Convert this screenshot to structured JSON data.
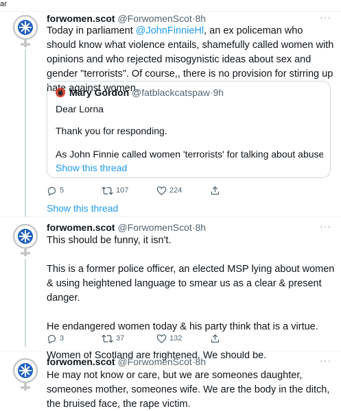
{
  "topbar": {
    "fragment": "ar"
  },
  "colors": {
    "link": "#1d9bf0",
    "muted": "#536471",
    "text": "#0f1419",
    "border": "#cfd9de"
  },
  "tweets": [
    {
      "name": "forwomen.scot",
      "handle": "@ForwomenScot",
      "time": "8h",
      "avatar_icon": "venus-logo-icon",
      "text": {
        "before": "Today in parliament ",
        "mention": "@JohnFinnieHl",
        "after": ", an ex policeman who should know what violence entails, shamefully called women with opinions and who rejected misogynistic ideas about sex and gender \"terrorists\". Of course,, there is no provision for stirring up hate against women."
      },
      "quote": {
        "name": "Mary Gordon",
        "handle": "@fatblackcatspaw",
        "time": "9h",
        "lines": [
          "Dear Lorna",
          "Thank you for responding.",
          "As John Finnie called women 'terrorists' for talking about abuse a..."
        ],
        "show_thread": "Show this thread"
      },
      "actions": {
        "replies": "5",
        "retweets": "107",
        "likes": "224"
      },
      "show_thread": "Show this thread"
    },
    {
      "name": "forwomen.scot",
      "handle": "@ForwomenScot",
      "time": "8h",
      "avatar_icon": "venus-logo-icon",
      "paragraphs": [
        "This should be funny, it isn't.",
        "This is a former police officer, an elected MSP lying about women & using heightened language to smear us as a clear & present danger.",
        "He endangered women today & his party think that is a virtue.",
        "Women of Scotland are frightened. We should be."
      ],
      "actions": {
        "replies": "3",
        "retweets": "37",
        "likes": "132"
      }
    },
    {
      "name": "forwomen.scot",
      "handle": "@ForwomenScot",
      "time": "8h",
      "avatar_icon": "venus-logo-icon",
      "paragraphs": [
        "He may not know or care, but we are someones daughter, someones mother, someones wife. We are the body in the ditch, the bruised face, the rape victim."
      ]
    }
  ],
  "separator": "·"
}
